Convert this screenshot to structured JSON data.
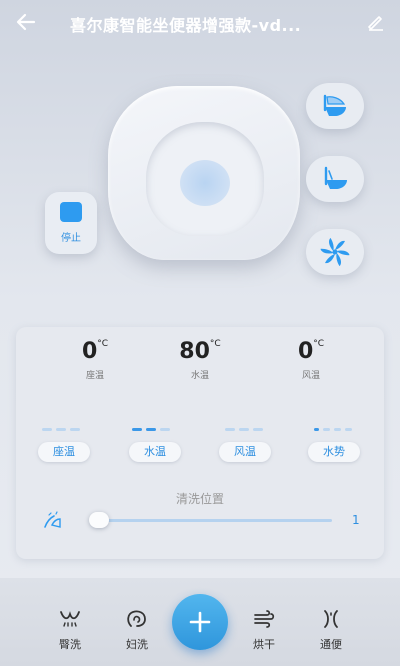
{
  "header": {
    "title": "喜尔康智能坐便器增强款-vd...",
    "back_icon": "back-arrow-icon",
    "edit_icon": "edit-pencil-icon"
  },
  "device": {
    "stop_label": "停止",
    "side_buttons": [
      "seat-lid-open-icon",
      "seat-lid-close-icon",
      "fan-icon"
    ]
  },
  "panel": {
    "temps": [
      {
        "value": "0",
        "unit": "°C",
        "label": "座温"
      },
      {
        "value": "80",
        "unit": "°C",
        "label": "水温"
      },
      {
        "value": "0",
        "unit": "°C",
        "label": "风温"
      }
    ],
    "levels": [
      {
        "label": "座温",
        "level": 0,
        "max": 3
      },
      {
        "label": "水温",
        "level": 2,
        "max": 3
      },
      {
        "label": "风温",
        "level": 0,
        "max": 3
      },
      {
        "label": "水势",
        "level": 1,
        "max": 4
      }
    ],
    "position": {
      "title": "清洗位置",
      "value": "1",
      "level": 0.02
    }
  },
  "bottom_nav": {
    "items": [
      {
        "label": "臀洗",
        "icon": "hip-wash-icon"
      },
      {
        "label": "妇洗",
        "icon": "feminine-wash-icon"
      },
      {
        "label": "烘干",
        "icon": "dry-icon"
      },
      {
        "label": "通便",
        "icon": "bowel-assist-icon"
      }
    ],
    "fab_icon": "plus-icon"
  },
  "colors": {
    "accent": "#2e9bf0",
    "track": "#b5d2ef"
  }
}
